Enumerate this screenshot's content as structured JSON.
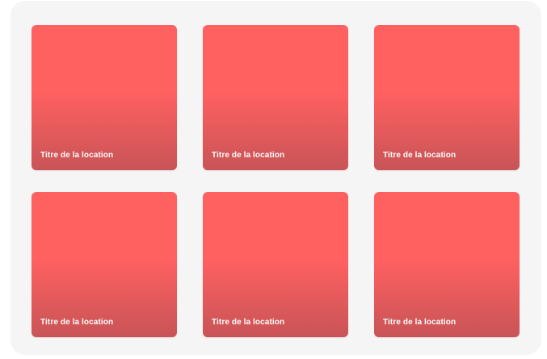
{
  "locations": [
    {
      "title": "Titre de la location"
    },
    {
      "title": "Titre de la location"
    },
    {
      "title": "Titre de la location"
    },
    {
      "title": "Titre de la location"
    },
    {
      "title": "Titre de la location"
    },
    {
      "title": "Titre de la location"
    }
  ],
  "colors": {
    "card_top": "#ff6060",
    "card_bottom": "#c85457",
    "panel_background": "#f6f5f5",
    "title_text": "#ffffff"
  }
}
